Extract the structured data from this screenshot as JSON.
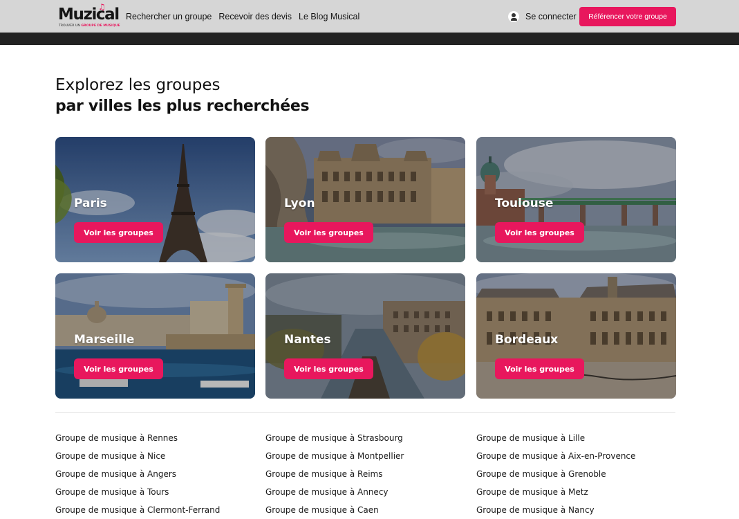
{
  "header": {
    "logo_text": "Muzical",
    "logo_tagline_a": "TROUVER UN",
    "logo_tagline_b": "GROUPE DE MUSIQUE",
    "nav": [
      {
        "label": "Rechercher un groupe"
      },
      {
        "label": "Recevoir des devis"
      },
      {
        "label": "Le Blog Musical"
      }
    ],
    "login_label": "Se connecter",
    "cta_label": "Référencer votre groupe"
  },
  "section": {
    "title_line1": "Explorez les groupes",
    "title_line2": "par villes les plus recherchées"
  },
  "cities": [
    {
      "name": "Paris",
      "button": "Voir les groupes"
    },
    {
      "name": "Lyon",
      "button": "Voir les groupes"
    },
    {
      "name": "Toulouse",
      "button": "Voir les groupes"
    },
    {
      "name": "Marseille",
      "button": "Voir les groupes"
    },
    {
      "name": "Nantes",
      "button": "Voir les groupes"
    },
    {
      "name": "Bordeaux",
      "button": "Voir les groupes"
    }
  ],
  "city_links": [
    [
      "Groupe de musique à Rennes",
      "Groupe de musique à Nice",
      "Groupe de musique à Angers",
      "Groupe de musique à Tours",
      "Groupe de musique à Clermont-Ferrand"
    ],
    [
      "Groupe de musique à Strasbourg",
      "Groupe de musique à Montpellier",
      "Groupe de musique à Reims",
      "Groupe de musique à Annecy",
      "Groupe de musique à Caen"
    ],
    [
      "Groupe de musique à Lille",
      "Groupe de musique à Aix-en-Provence",
      "Groupe de musique à Grenoble",
      "Groupe de musique à Metz",
      "Groupe de musique à Nancy"
    ]
  ],
  "colors": {
    "accent": "#e8175d",
    "header_bg": "#d6d6d6",
    "header_strip": "#222222"
  }
}
